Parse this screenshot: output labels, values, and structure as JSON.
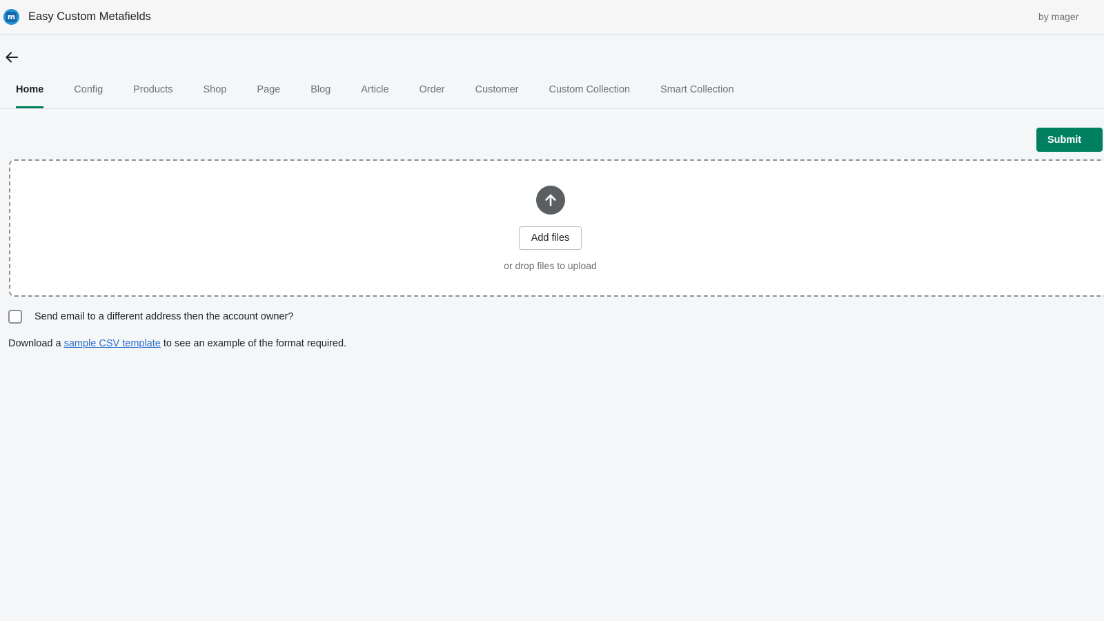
{
  "appbar": {
    "logo_icon": "metafields-app-logo-icon",
    "logo_letter": "m",
    "title": "Easy Custom Metafields",
    "byline": "by mager"
  },
  "navigation": {
    "back_icon": "arrow-left-icon",
    "tabs": [
      {
        "label": "Home",
        "active": true
      },
      {
        "label": "Config",
        "active": false
      },
      {
        "label": "Products",
        "active": false
      },
      {
        "label": "Shop",
        "active": false
      },
      {
        "label": "Page",
        "active": false
      },
      {
        "label": "Blog",
        "active": false
      },
      {
        "label": "Article",
        "active": false
      },
      {
        "label": "Order",
        "active": false
      },
      {
        "label": "Customer",
        "active": false
      },
      {
        "label": "Custom Collection",
        "active": false
      },
      {
        "label": "Smart Collection",
        "active": false
      }
    ],
    "active_color": "#008060"
  },
  "actions": {
    "submit_label": "Submit",
    "submit_color": "#008060"
  },
  "dropzone": {
    "upload_icon": "upload-arrow-icon",
    "add_files_label": "Add files",
    "drop_hint": "or drop files to upload"
  },
  "options": {
    "email_checkbox_label": "Send email to a different address then the account owner?",
    "email_checkbox_checked": false
  },
  "footer_note": {
    "prefix": "Download a ",
    "link_label": "sample CSV template",
    "suffix": " to see an example of the format required.",
    "link_color": "#2c6ecb"
  }
}
